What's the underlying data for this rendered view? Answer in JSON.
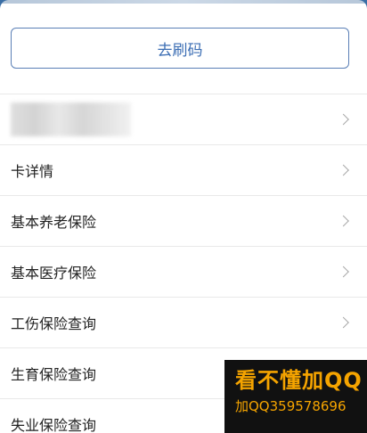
{
  "refresh_button": {
    "label": "去刷码"
  },
  "list": {
    "items": [
      {
        "label": ""
      },
      {
        "label": "卡详情"
      },
      {
        "label": "基本养老保险"
      },
      {
        "label": "基本医疗保险"
      },
      {
        "label": "工伤保险查询"
      },
      {
        "label": "生育保险查询"
      },
      {
        "label": "失业保险查询"
      }
    ]
  },
  "watermark": {
    "line1": "看不懂加QQ",
    "line2": "加QQ359578696"
  },
  "colors": {
    "accent": "#3c6eb4",
    "watermark_text": "#f5a400",
    "watermark_bg": "#111111"
  },
  "icons": {
    "row_chevron": "chevron-right-icon"
  }
}
